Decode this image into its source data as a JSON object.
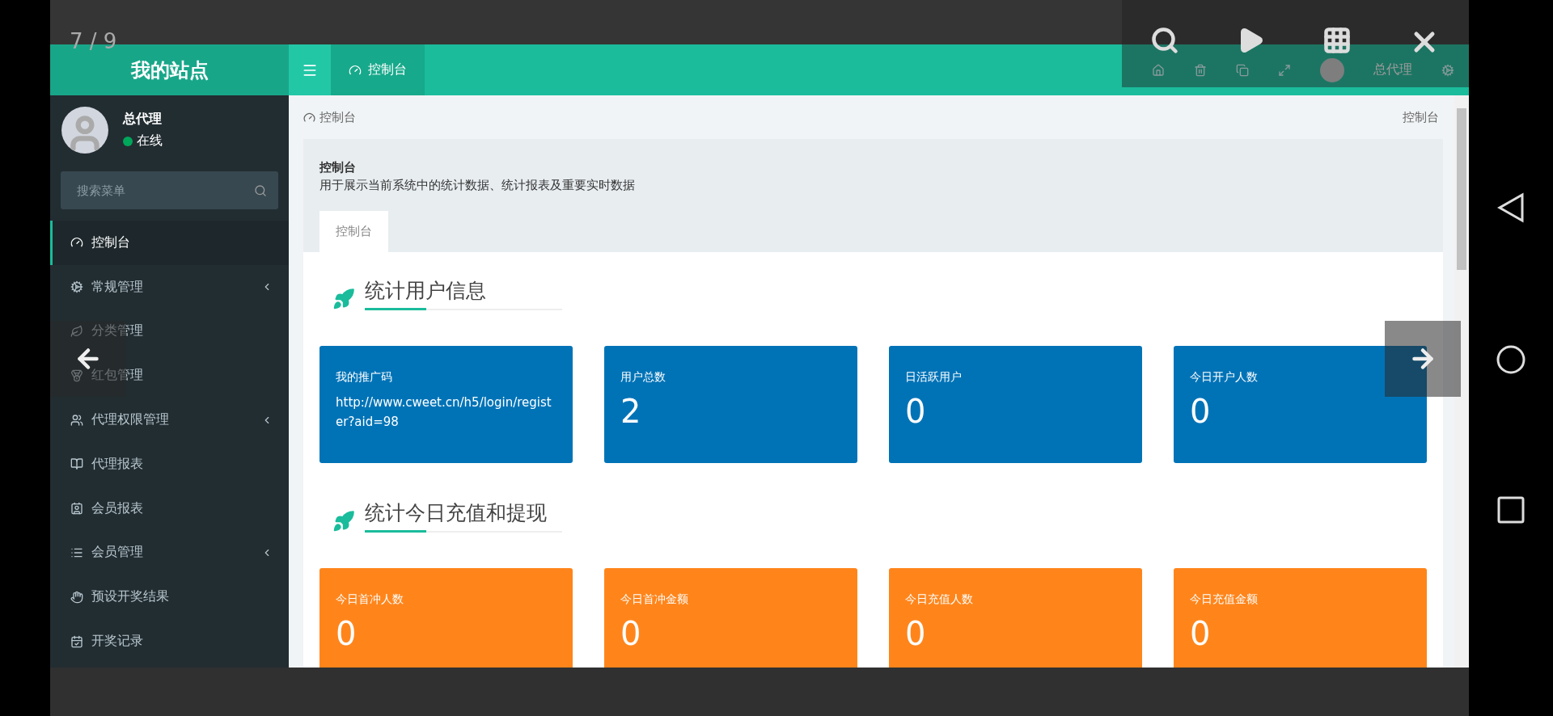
{
  "viewer": {
    "counter": "7 / 9"
  },
  "header": {
    "logo": "我的站点",
    "tab": {
      "label": "控制台",
      "selected": true
    },
    "user": "总代理"
  },
  "user_panel": {
    "name": "总代理",
    "status": "在线",
    "online": true
  },
  "search": {
    "placeholder": "搜索菜单"
  },
  "sidebar": {
    "items": [
      {
        "label": "控制台",
        "selected": true,
        "has_submenu": false
      },
      {
        "label": "常规管理",
        "selected": false,
        "has_submenu": true
      },
      {
        "label": "分类管理",
        "selected": false,
        "has_submenu": false
      },
      {
        "label": "红包管理",
        "selected": false,
        "has_submenu": false
      },
      {
        "label": "代理权限管理",
        "selected": false,
        "has_submenu": true
      },
      {
        "label": "代理报表",
        "selected": false,
        "has_submenu": false
      },
      {
        "label": "会员报表",
        "selected": false,
        "has_submenu": false
      },
      {
        "label": "会员管理",
        "selected": false,
        "has_submenu": true
      },
      {
        "label": "预设开奖结果",
        "selected": false,
        "has_submenu": false
      },
      {
        "label": "开奖记录",
        "selected": false,
        "has_submenu": false
      }
    ]
  },
  "breadcrumb": {
    "left": "控制台",
    "right": "控制台"
  },
  "panel": {
    "title": "控制台",
    "description": "用于展示当前系统中的统计数据、统计报表及重要实时数据",
    "tabs": [
      {
        "label": "控制台",
        "selected": true
      }
    ]
  },
  "sections": [
    {
      "title": "统计用户信息",
      "color": "#0073b7",
      "cards": [
        {
          "kind": "link",
          "label": "我的推广码",
          "text": "http://www.cweet.cn/h5/login/register?aid=98"
        },
        {
          "kind": "count",
          "label": "用户总数",
          "text": "2"
        },
        {
          "kind": "count",
          "label": "日活跃用户",
          "text": "0"
        },
        {
          "kind": "count",
          "label": "今日开户人数",
          "text": "0"
        }
      ]
    },
    {
      "title": "统计今日充值和提现",
      "color": "#ff851b",
      "cards": [
        {
          "kind": "count",
          "label": "今日首冲人数",
          "text": "0"
        },
        {
          "kind": "count",
          "label": "今日首冲金额",
          "text": "0"
        },
        {
          "kind": "count",
          "label": "今日充值人数",
          "text": "0"
        },
        {
          "kind": "count",
          "label": "今日充值金额",
          "text": "0"
        }
      ]
    }
  ]
}
